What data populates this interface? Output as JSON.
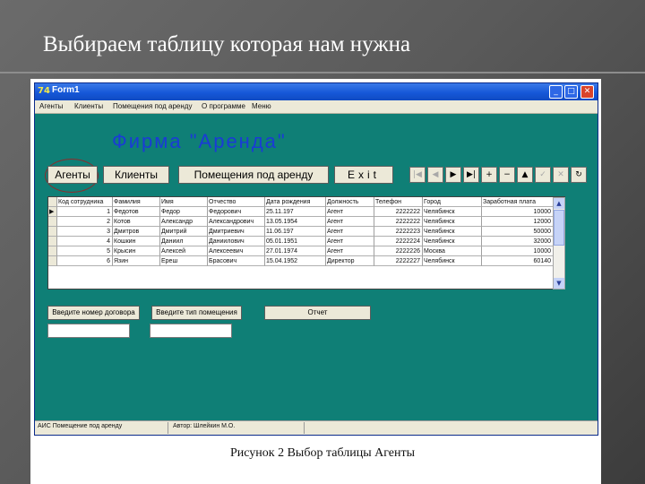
{
  "slide": {
    "title": "Выбираем таблицу которая нам нужна",
    "caption": "Рисунок 2 Выбор таблицы Агенты"
  },
  "window": {
    "title": "Form1",
    "icon": "delphi-app-icon",
    "controls": {
      "minimize": "_",
      "maximize": "□",
      "close": "✕"
    }
  },
  "menu": [
    "Агенты",
    "Клиенты",
    "Помещения под аренду",
    "О программе",
    "Меню"
  ],
  "firm_title": "Фирма \"Аренда\"",
  "tabs": {
    "agents": "Агенты",
    "clients": "Клиенты",
    "premises": "Помещения под аренду",
    "exit": "Exit"
  },
  "navigator": [
    "|◀",
    "◀",
    "▶",
    "▶|",
    "+",
    "−",
    "▲",
    "✓",
    "✕",
    "↻"
  ],
  "grid": {
    "columns": [
      "Код сотрудника",
      "Фамилия",
      "Имя",
      "Отчество",
      "Дата рождения",
      "Должность",
      "Телефон",
      "Город",
      "Заработная плата"
    ],
    "rows": [
      [
        "1",
        "Федотов",
        "Федор",
        "Федорович",
        "25.11.197",
        "Агент",
        "2222222",
        "Челябинск",
        "10000"
      ],
      [
        "2",
        "Котов",
        "Александр",
        "Александрович",
        "13.05.1954",
        "Агент",
        "2222222",
        "Челябинск",
        "12000"
      ],
      [
        "3",
        "Дмитров",
        "Дмитрий",
        "Дмитриевич",
        "11.06.197",
        "Агент",
        "2222223",
        "Челябинск",
        "50000"
      ],
      [
        "4",
        "Кошкин",
        "Даниил",
        "Даниилович",
        "05.01.1951",
        "Агент",
        "2222224",
        "Челябинск",
        "32000"
      ],
      [
        "5",
        "Крысин",
        "Алексей",
        "Алексеевич",
        "27.01.1974",
        "Агент",
        "2222226",
        "Москва",
        "10000"
      ],
      [
        "6",
        "Язин",
        "Ереш",
        "Брасович",
        "15.04.1952",
        "Директор",
        "2222227",
        "Челябинск",
        "60140"
      ]
    ]
  },
  "actions": {
    "contract": "Введите номер договора",
    "premise_type": "Введите тип помещения",
    "report": "Отчет"
  },
  "status": {
    "left": "АИС Помещение под аренду",
    "right": "Автор: Шлейкин М.О."
  }
}
